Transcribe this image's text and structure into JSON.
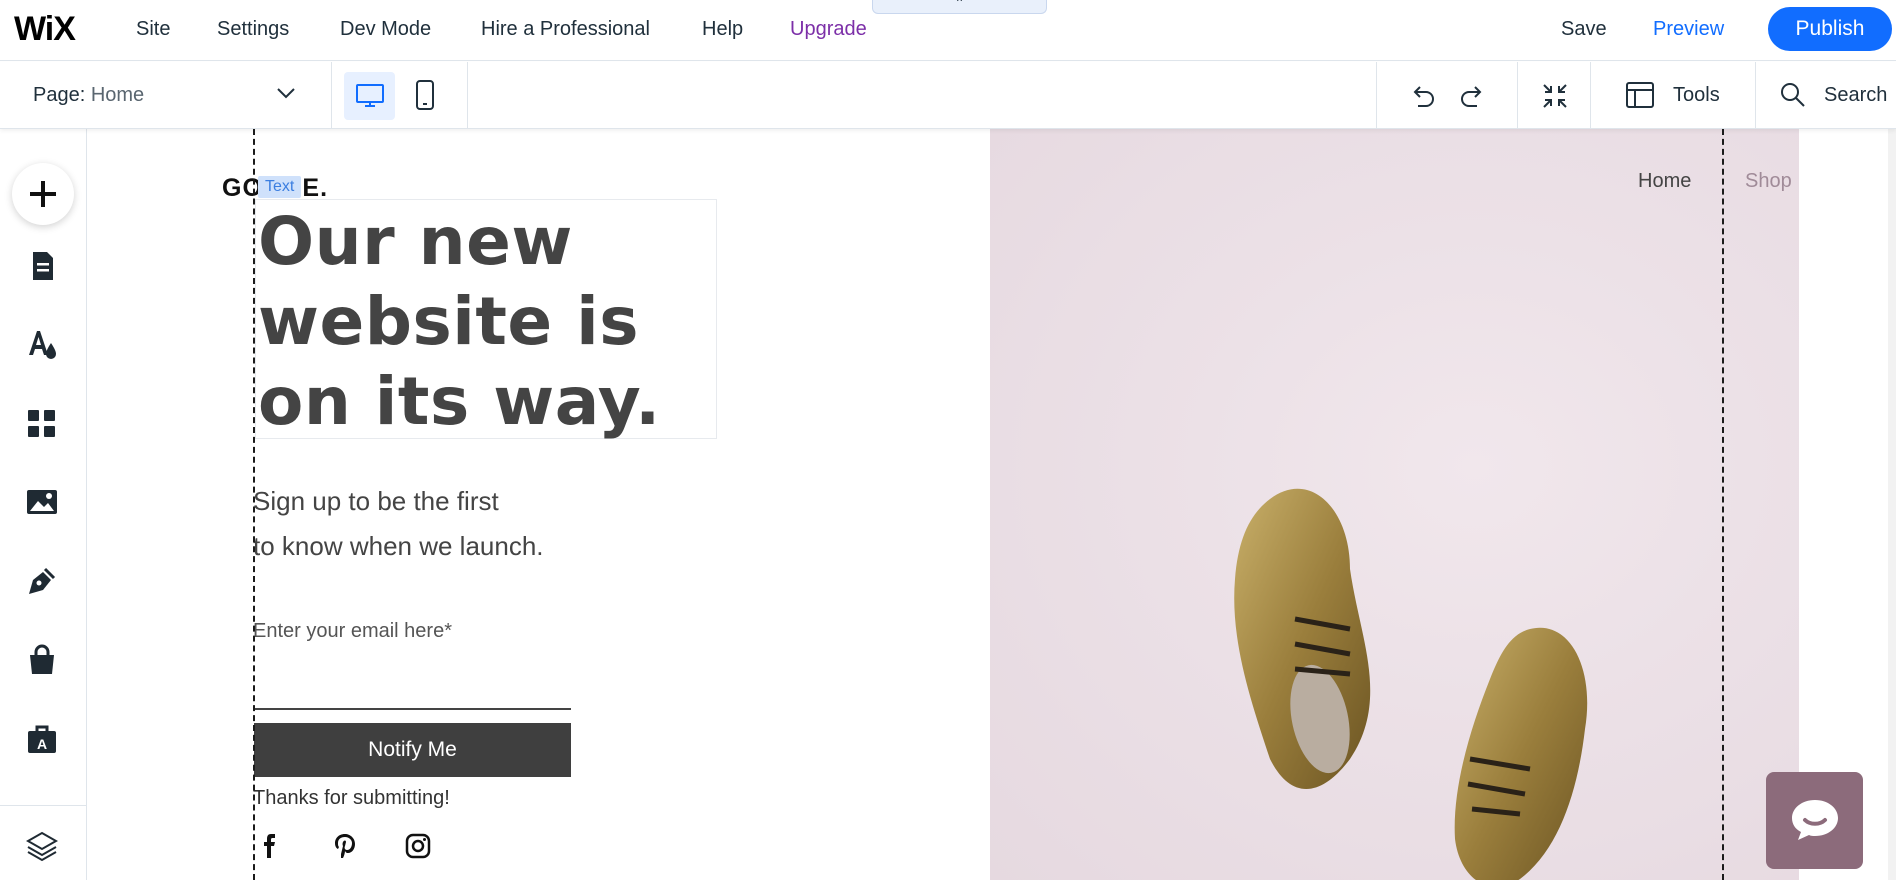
{
  "topbar": {
    "logo": "WiX",
    "menu": [
      "Site",
      "Settings",
      "Dev Mode",
      "Hire a Professional",
      "Help",
      "Upgrade"
    ],
    "collapse_glyph": "⌃",
    "save_label": "Save",
    "preview_label": "Preview",
    "publish_label": "Publish"
  },
  "toolbar": {
    "page_prefix": "Page:",
    "page_name": "Home",
    "tools_label": "Tools",
    "search_label": "Search"
  },
  "sidebar": {
    "icons": [
      "add-icon",
      "pages-icon",
      "design-icon",
      "apps-icon",
      "media-icon",
      "blog-icon",
      "store-icon",
      "portfolio-icon",
      "layers-icon"
    ]
  },
  "site": {
    "logo": "GOODE.",
    "text_badge": "Text",
    "headline": "Our new website is on its way.",
    "subhead_line1": "Sign up to be the first",
    "subhead_line2": "to know when we launch.",
    "email_label": "Enter your email here*",
    "notify_label": "Notify Me",
    "thanks": "Thanks for submitting!",
    "nav": [
      "Home",
      "Shop"
    ],
    "social_icons": [
      "facebook-icon",
      "pinterest-icon",
      "instagram-icon"
    ]
  },
  "colors": {
    "brand_blue": "#116dff",
    "upgrade_purple": "#7c2fa8",
    "hero_bg": "#ece1e7",
    "button_dark": "#3f3f3f",
    "chat_bg": "#8c6b7b"
  }
}
